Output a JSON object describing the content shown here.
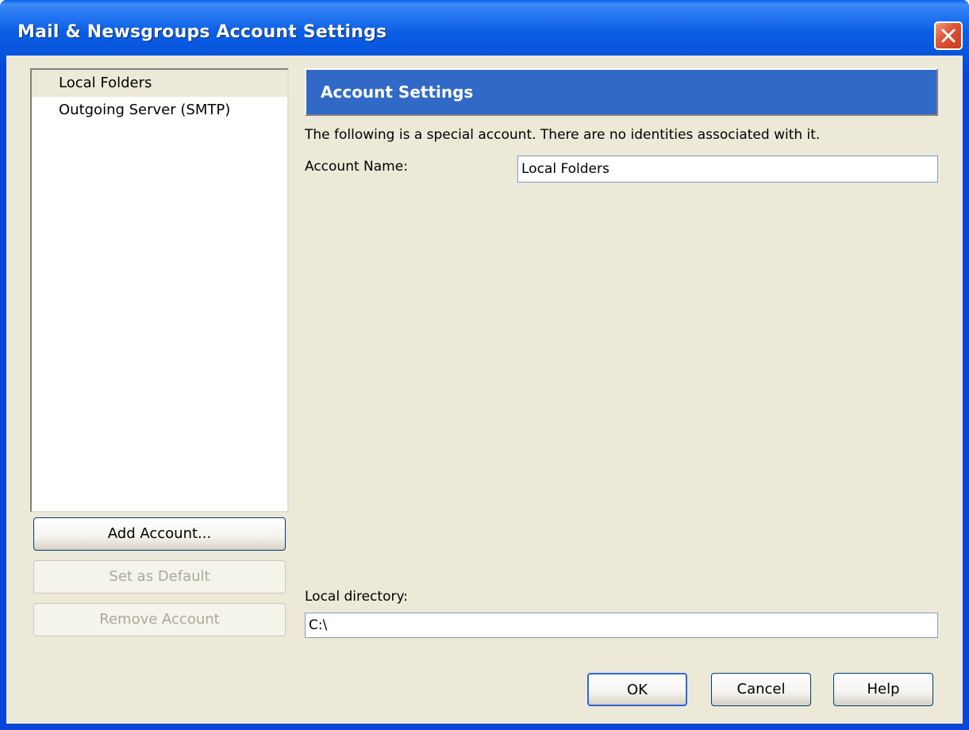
{
  "window": {
    "title": "Mail & Newsgroups Account Settings"
  },
  "account_list": {
    "items": [
      {
        "label": "Local Folders",
        "selected": true
      },
      {
        "label": "Outgoing Server (SMTP)",
        "selected": false
      }
    ]
  },
  "account_buttons": {
    "add_label": "Add Account...",
    "set_default_label": "Set as Default",
    "remove_label": "Remove Account"
  },
  "panel": {
    "title": "Account Settings",
    "description": "The following is a special account. There are no identities associated with it.",
    "account_name_label": "Account Name:",
    "account_name_value": "Local Folders",
    "local_dir_label": "Local directory:",
    "local_dir_value": "C:\\"
  },
  "dialog_buttons": {
    "ok_label": "OK",
    "cancel_label": "Cancel",
    "help_label": "Help"
  },
  "colors": {
    "titlebar": "#0054e3",
    "panel_header": "#3169c6",
    "dialog_bg": "#ece9d8",
    "close_button": "#e0563a"
  },
  "icons": {
    "close": "close-icon"
  }
}
